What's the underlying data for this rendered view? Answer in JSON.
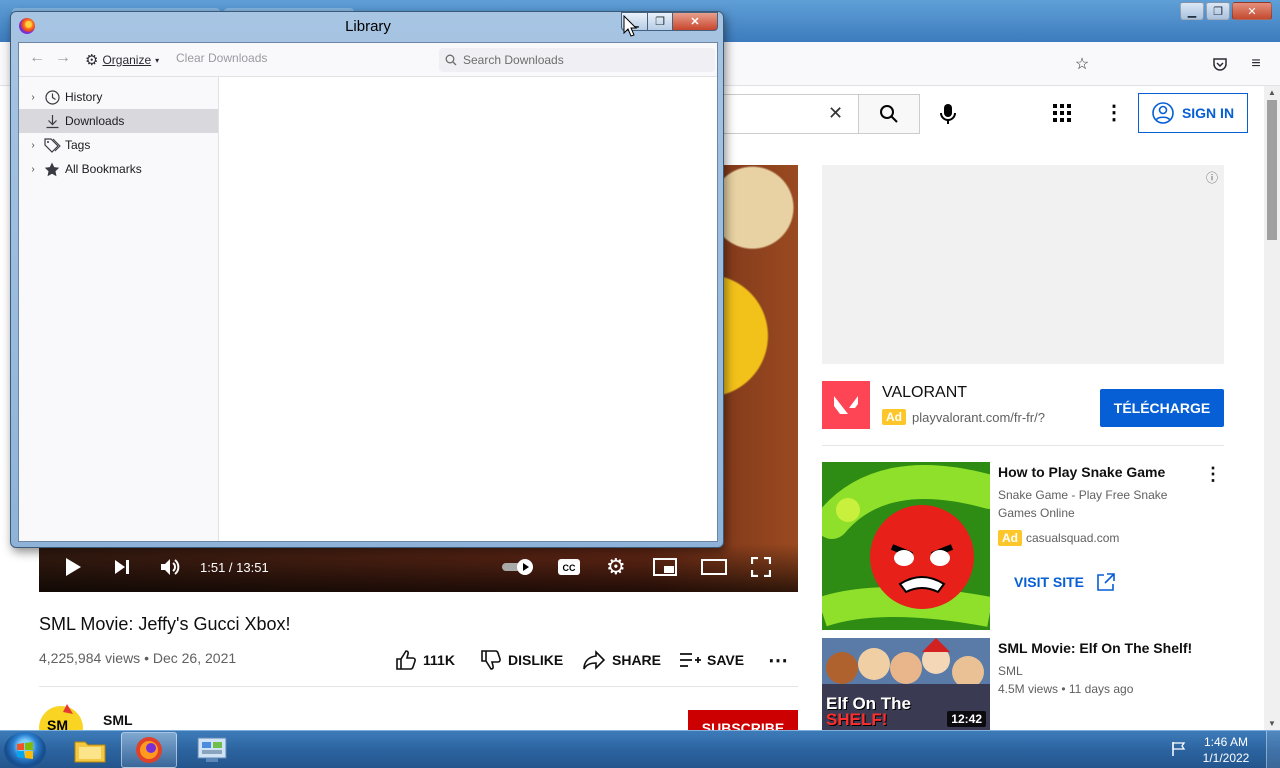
{
  "library": {
    "title": "Library",
    "toolbar": {
      "organize": "Organize",
      "clear_downloads": "Clear Downloads",
      "search_placeholder": "Search Downloads"
    },
    "sidebar": {
      "items": [
        {
          "label": "History",
          "icon": "clock-icon",
          "expandable": true
        },
        {
          "label": "Downloads",
          "icon": "download-icon",
          "expandable": false,
          "selected": true
        },
        {
          "label": "Tags",
          "icon": "tag-icon",
          "expandable": true
        },
        {
          "label": "All Bookmarks",
          "icon": "star-icon",
          "expandable": true
        }
      ]
    }
  },
  "youtube": {
    "sign_in": "SIGN IN",
    "video": {
      "time": "1:51 / 13:51",
      "title": "SML Movie: Jeffy's Gucci Xbox!",
      "meta": "4,225,984 views • Dec 26, 2021",
      "actions": {
        "likes": "111K",
        "dislike": "DISLIKE",
        "share": "SHARE",
        "save": "SAVE"
      },
      "channel": "SML",
      "subscribe": "SUBSCRIBE"
    },
    "ad": {
      "brand": "VALORANT",
      "badge": "Ad",
      "url": "playvalorant.com/fr-fr/?",
      "cta": "TÉLÉCHARGE",
      "brand_color": "#fd4556"
    },
    "recommendations": [
      {
        "title": "How to Play Snake Game",
        "subtitle": "Snake Game - Play Free Snake Games Online",
        "badge": "Ad",
        "domain": "casualsquad.com",
        "cta": "VISIT SITE"
      },
      {
        "title": "SML Movie: Elf On The Shelf!",
        "channel": "SML",
        "meta": "4.5M views • 11 days ago",
        "duration": "12:42",
        "thumb_caption_top": "Elf On The",
        "thumb_caption_bottom": "SHELF!"
      }
    ]
  },
  "taskbar": {
    "time": "1:46 AM",
    "date": "1/1/2022"
  },
  "colors": {
    "youtube_blue": "#065fd4",
    "subscribe_red": "#cc0000",
    "ad_yellow": "#fdc72c"
  }
}
